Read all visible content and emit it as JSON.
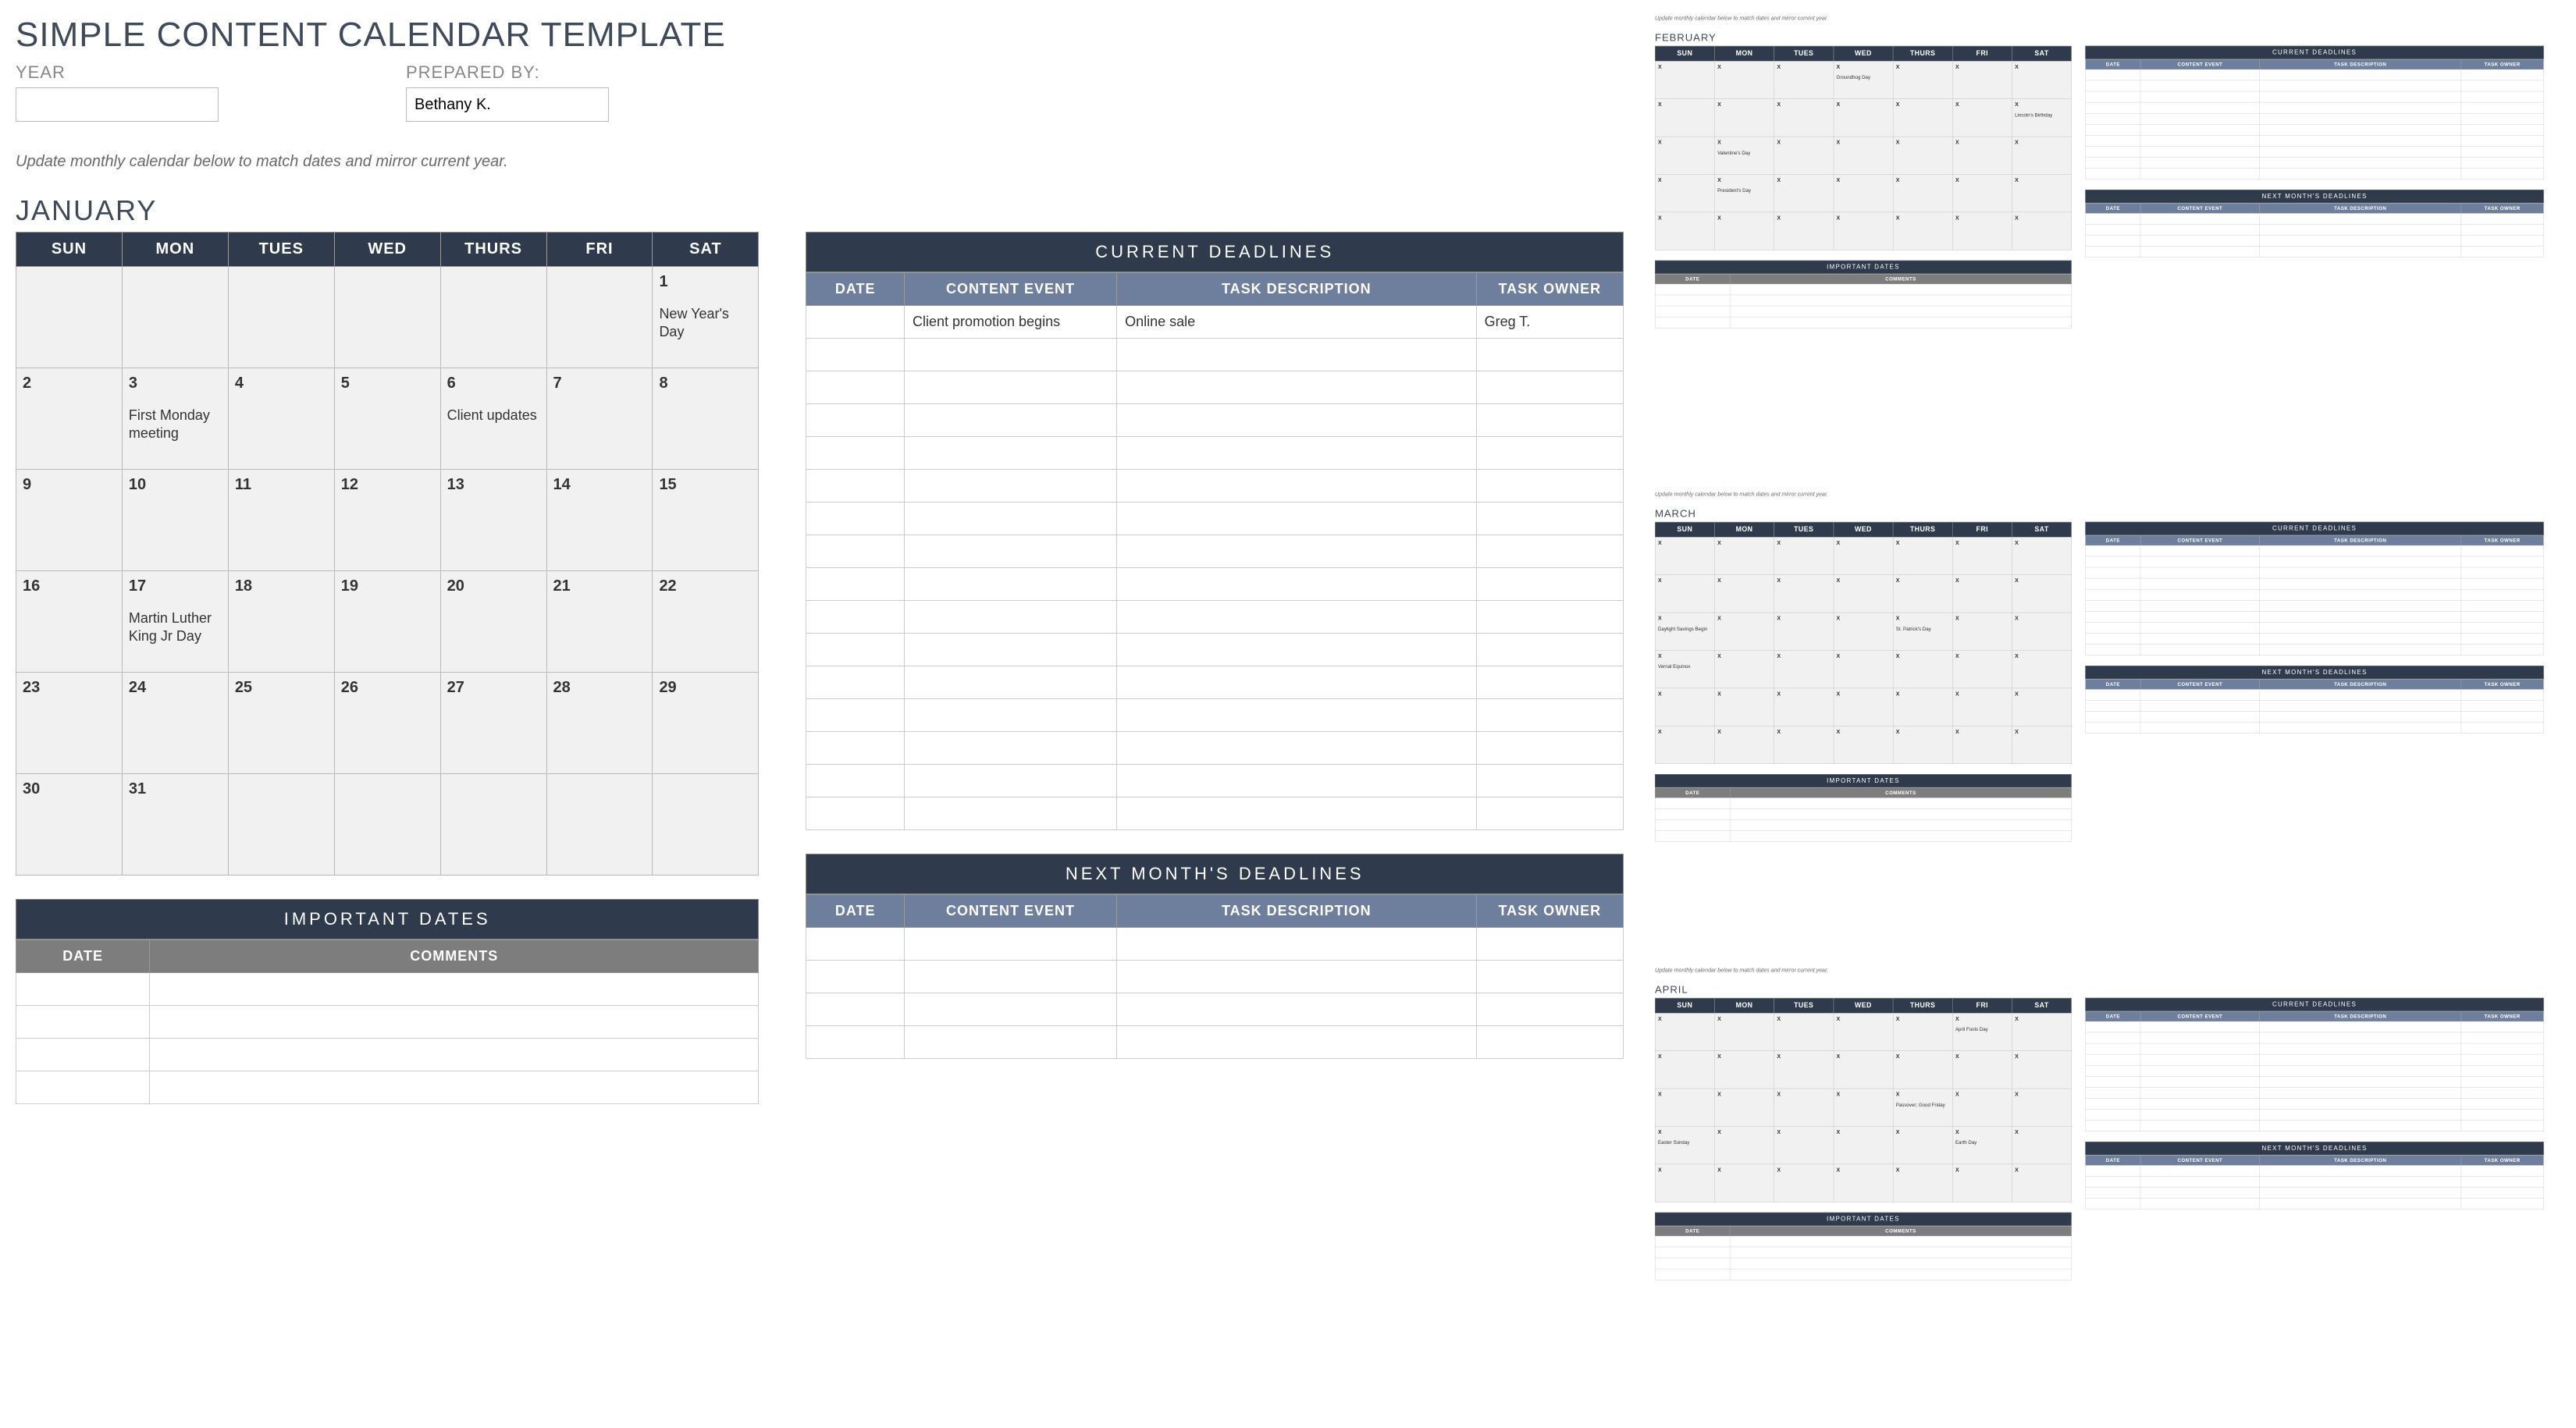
{
  "title": "SIMPLE CONTENT CALENDAR TEMPLATE",
  "fields": {
    "year_label": "YEAR",
    "year_value": "",
    "prepared_label": "PREPARED BY:",
    "prepared_value": "Bethany K."
  },
  "instruction": "Update monthly calendar below to match dates and mirror current year.",
  "weekdays": [
    "SUN",
    "MON",
    "TUES",
    "WED",
    "THURS",
    "FRI",
    "SAT"
  ],
  "sections": {
    "current_deadlines": "CURRENT  DEADLINES",
    "important_dates": "IMPORTANT  DATES",
    "next_month_deadlines": "NEXT  MONTH'S  DEADLINES",
    "cols_deadlines": [
      "DATE",
      "CONTENT EVENT",
      "TASK DESCRIPTION",
      "TASK OWNER"
    ],
    "cols_important": [
      "DATE",
      "COMMENTS"
    ]
  },
  "months": {
    "january": {
      "name": "JANUARY",
      "weeks": [
        [
          {
            "d": "",
            "n": ""
          },
          {
            "d": "",
            "n": ""
          },
          {
            "d": "",
            "n": ""
          },
          {
            "d": "",
            "n": ""
          },
          {
            "d": "",
            "n": ""
          },
          {
            "d": "",
            "n": ""
          },
          {
            "d": "1",
            "n": "New Year's Day"
          }
        ],
        [
          {
            "d": "2",
            "n": ""
          },
          {
            "d": "3",
            "n": "First Monday meeting"
          },
          {
            "d": "4",
            "n": ""
          },
          {
            "d": "5",
            "n": ""
          },
          {
            "d": "6",
            "n": "Client updates"
          },
          {
            "d": "7",
            "n": ""
          },
          {
            "d": "8",
            "n": ""
          }
        ],
        [
          {
            "d": "9",
            "n": ""
          },
          {
            "d": "10",
            "n": ""
          },
          {
            "d": "11",
            "n": ""
          },
          {
            "d": "12",
            "n": ""
          },
          {
            "d": "13",
            "n": ""
          },
          {
            "d": "14",
            "n": ""
          },
          {
            "d": "15",
            "n": ""
          }
        ],
        [
          {
            "d": "16",
            "n": ""
          },
          {
            "d": "17",
            "n": "Martin Luther King Jr Day"
          },
          {
            "d": "18",
            "n": ""
          },
          {
            "d": "19",
            "n": ""
          },
          {
            "d": "20",
            "n": ""
          },
          {
            "d": "21",
            "n": ""
          },
          {
            "d": "22",
            "n": ""
          }
        ],
        [
          {
            "d": "23",
            "n": ""
          },
          {
            "d": "24",
            "n": ""
          },
          {
            "d": "25",
            "n": ""
          },
          {
            "d": "26",
            "n": ""
          },
          {
            "d": "27",
            "n": ""
          },
          {
            "d": "28",
            "n": ""
          },
          {
            "d": "29",
            "n": ""
          }
        ],
        [
          {
            "d": "30",
            "n": ""
          },
          {
            "d": "31",
            "n": ""
          },
          {
            "d": "",
            "n": ""
          },
          {
            "d": "",
            "n": ""
          },
          {
            "d": "",
            "n": ""
          },
          {
            "d": "",
            "n": ""
          },
          {
            "d": "",
            "n": ""
          }
        ]
      ],
      "current_deadlines_rows": [
        {
          "date": "",
          "event": "Client promotion begins",
          "task": "Online sale",
          "owner": "Greg T."
        }
      ]
    },
    "february": {
      "name": "FEBRUARY",
      "weeks": [
        [
          {
            "d": "X",
            "n": ""
          },
          {
            "d": "X",
            "n": ""
          },
          {
            "d": "X",
            "n": ""
          },
          {
            "d": "X",
            "n": "Groundhog Day"
          },
          {
            "d": "X",
            "n": ""
          },
          {
            "d": "X",
            "n": ""
          },
          {
            "d": "X",
            "n": ""
          }
        ],
        [
          {
            "d": "X",
            "n": ""
          },
          {
            "d": "X",
            "n": ""
          },
          {
            "d": "X",
            "n": ""
          },
          {
            "d": "X",
            "n": ""
          },
          {
            "d": "X",
            "n": ""
          },
          {
            "d": "X",
            "n": ""
          },
          {
            "d": "X",
            "n": "Lincoln's Birthday"
          }
        ],
        [
          {
            "d": "X",
            "n": ""
          },
          {
            "d": "X",
            "n": "Valentine's Day"
          },
          {
            "d": "X",
            "n": ""
          },
          {
            "d": "X",
            "n": ""
          },
          {
            "d": "X",
            "n": ""
          },
          {
            "d": "X",
            "n": ""
          },
          {
            "d": "X",
            "n": ""
          }
        ],
        [
          {
            "d": "X",
            "n": ""
          },
          {
            "d": "X",
            "n": "President's Day"
          },
          {
            "d": "X",
            "n": ""
          },
          {
            "d": "X",
            "n": ""
          },
          {
            "d": "X",
            "n": ""
          },
          {
            "d": "X",
            "n": ""
          },
          {
            "d": "X",
            "n": ""
          }
        ],
        [
          {
            "d": "X",
            "n": ""
          },
          {
            "d": "X",
            "n": ""
          },
          {
            "d": "X",
            "n": ""
          },
          {
            "d": "X",
            "n": ""
          },
          {
            "d": "X",
            "n": ""
          },
          {
            "d": "X",
            "n": ""
          },
          {
            "d": "X",
            "n": ""
          }
        ]
      ],
      "current_deadlines_rows": []
    },
    "march": {
      "name": "MARCH",
      "weeks": [
        [
          {
            "d": "X",
            "n": ""
          },
          {
            "d": "X",
            "n": ""
          },
          {
            "d": "X",
            "n": ""
          },
          {
            "d": "X",
            "n": ""
          },
          {
            "d": "X",
            "n": ""
          },
          {
            "d": "X",
            "n": ""
          },
          {
            "d": "X",
            "n": ""
          }
        ],
        [
          {
            "d": "X",
            "n": ""
          },
          {
            "d": "X",
            "n": ""
          },
          {
            "d": "X",
            "n": ""
          },
          {
            "d": "X",
            "n": ""
          },
          {
            "d": "X",
            "n": ""
          },
          {
            "d": "X",
            "n": ""
          },
          {
            "d": "X",
            "n": ""
          }
        ],
        [
          {
            "d": "X",
            "n": "Daylight Savings Begin"
          },
          {
            "d": "X",
            "n": ""
          },
          {
            "d": "X",
            "n": ""
          },
          {
            "d": "X",
            "n": ""
          },
          {
            "d": "X",
            "n": "St. Patrick's Day"
          },
          {
            "d": "X",
            "n": ""
          },
          {
            "d": "X",
            "n": ""
          }
        ],
        [
          {
            "d": "X",
            "n": "Vernal Equinox"
          },
          {
            "d": "X",
            "n": ""
          },
          {
            "d": "X",
            "n": ""
          },
          {
            "d": "X",
            "n": ""
          },
          {
            "d": "X",
            "n": ""
          },
          {
            "d": "X",
            "n": ""
          },
          {
            "d": "X",
            "n": ""
          }
        ],
        [
          {
            "d": "X",
            "n": ""
          },
          {
            "d": "X",
            "n": ""
          },
          {
            "d": "X",
            "n": ""
          },
          {
            "d": "X",
            "n": ""
          },
          {
            "d": "X",
            "n": ""
          },
          {
            "d": "X",
            "n": ""
          },
          {
            "d": "X",
            "n": ""
          }
        ],
        [
          {
            "d": "X",
            "n": ""
          },
          {
            "d": "X",
            "n": ""
          },
          {
            "d": "X",
            "n": ""
          },
          {
            "d": "X",
            "n": ""
          },
          {
            "d": "X",
            "n": ""
          },
          {
            "d": "X",
            "n": ""
          },
          {
            "d": "X",
            "n": ""
          }
        ]
      ],
      "current_deadlines_rows": []
    },
    "april": {
      "name": "APRIL",
      "weeks": [
        [
          {
            "d": "X",
            "n": ""
          },
          {
            "d": "X",
            "n": ""
          },
          {
            "d": "X",
            "n": ""
          },
          {
            "d": "X",
            "n": ""
          },
          {
            "d": "X",
            "n": ""
          },
          {
            "d": "X",
            "n": "April Fools Day"
          },
          {
            "d": "X",
            "n": ""
          }
        ],
        [
          {
            "d": "X",
            "n": ""
          },
          {
            "d": "X",
            "n": ""
          },
          {
            "d": "X",
            "n": ""
          },
          {
            "d": "X",
            "n": ""
          },
          {
            "d": "X",
            "n": ""
          },
          {
            "d": "X",
            "n": ""
          },
          {
            "d": "X",
            "n": ""
          }
        ],
        [
          {
            "d": "X",
            "n": ""
          },
          {
            "d": "X",
            "n": ""
          },
          {
            "d": "X",
            "n": ""
          },
          {
            "d": "X",
            "n": ""
          },
          {
            "d": "X",
            "n": "Passover; Good Friday"
          },
          {
            "d": "X",
            "n": ""
          },
          {
            "d": "X",
            "n": ""
          }
        ],
        [
          {
            "d": "X",
            "n": "Easter Sunday"
          },
          {
            "d": "X",
            "n": ""
          },
          {
            "d": "X",
            "n": ""
          },
          {
            "d": "X",
            "n": ""
          },
          {
            "d": "X",
            "n": ""
          },
          {
            "d": "X",
            "n": "Earth Day"
          },
          {
            "d": "X",
            "n": ""
          }
        ],
        [
          {
            "d": "X",
            "n": ""
          },
          {
            "d": "X",
            "n": ""
          },
          {
            "d": "X",
            "n": ""
          },
          {
            "d": "X",
            "n": ""
          },
          {
            "d": "X",
            "n": ""
          },
          {
            "d": "X",
            "n": ""
          },
          {
            "d": "X",
            "n": ""
          }
        ]
      ],
      "current_deadlines_rows": []
    }
  }
}
